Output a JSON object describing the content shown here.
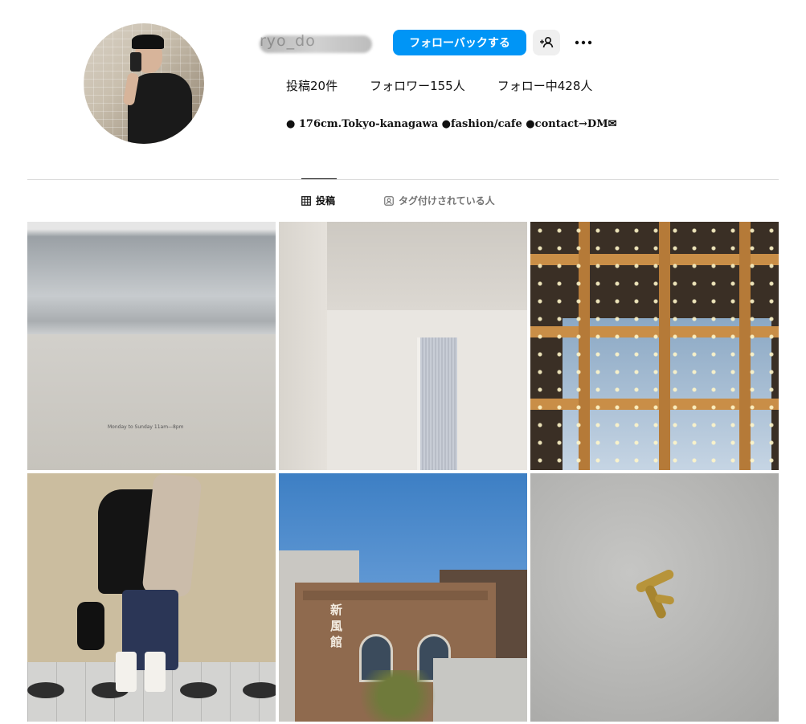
{
  "profile": {
    "username_visible": "ryo_do",
    "follow_back_label": "フォローバックする",
    "stats": {
      "posts": "投稿20件",
      "followers": "フォロワー155人",
      "following": "フォロー中428人"
    },
    "bio": "● 176cm.Tokyo-kanagawa ●fashion/cafe ●contact→DM✉"
  },
  "tabs": {
    "posts_label": "投稿",
    "tagged_label": "タグ付けされている人"
  },
  "grid": {
    "posts": [
      {
        "caption": "Monday to Sunday 11am—8pm"
      },
      {
        "caption": ""
      },
      {
        "caption": ""
      },
      {
        "caption": ""
      },
      {
        "caption": "新風館"
      },
      {
        "caption": ""
      }
    ]
  },
  "colors": {
    "accent": "#0095f6",
    "divider": "#dbdbdb",
    "secondary_text": "#737373"
  },
  "icons": {
    "suggest": "person-add-icon",
    "more": "more-horizontal-icon",
    "posts_tab": "grid-icon",
    "tagged_tab": "tagged-person-icon"
  }
}
